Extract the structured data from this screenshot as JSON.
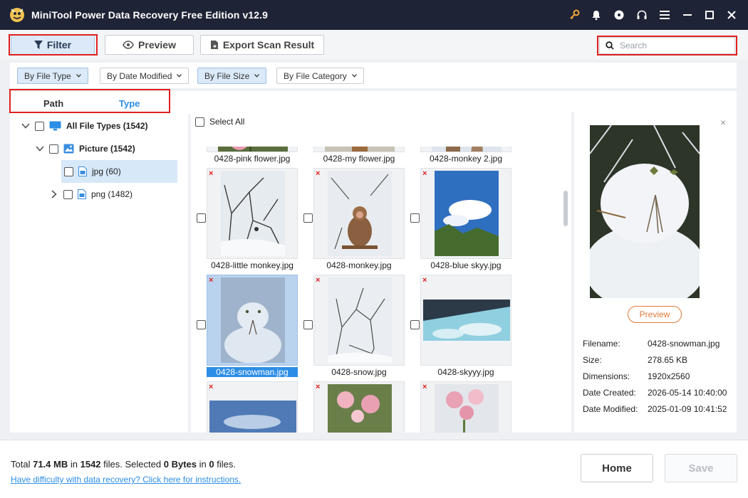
{
  "app": {
    "title": "MiniTool Power Data Recovery Free Edition v12.9"
  },
  "titlebar_icons": [
    "key-icon",
    "bell-icon",
    "disc-icon",
    "headset-icon",
    "menu-icon",
    "minimize-icon",
    "maximize-icon",
    "close-icon"
  ],
  "toolbar": {
    "filter_label": "Filter",
    "preview_label": "Preview",
    "export_label": "Export Scan Result",
    "search_placeholder": "Search"
  },
  "filters": [
    {
      "label": "By File Type",
      "active": true
    },
    {
      "label": "By Date Modified",
      "active": false
    },
    {
      "label": "By File Size",
      "active": true
    },
    {
      "label": "By File Category",
      "active": false
    }
  ],
  "tabs": {
    "path": "Path",
    "type": "Type"
  },
  "tree": {
    "all": "All File Types (1542)",
    "picture": "Picture (1542)",
    "jpg": "jpg (60)",
    "png": "png (1482)"
  },
  "grid": {
    "select_all": "Select All",
    "files": [
      {
        "name": "0428-pink flower.jpg",
        "deleted": false
      },
      {
        "name": "0428-my flower.jpg",
        "deleted": false
      },
      {
        "name": "0428-monkey 2.jpg",
        "deleted": false
      },
      {
        "name": "0428-little monkey.jpg",
        "deleted": true
      },
      {
        "name": "0428-monkey.jpg",
        "deleted": true
      },
      {
        "name": "0428-blue skyy.jpg",
        "deleted": true
      },
      {
        "name": "0428-snowman.jpg",
        "deleted": true,
        "selected": true
      },
      {
        "name": "0428-snow.jpg",
        "deleted": true
      },
      {
        "name": "0428-skyyy.jpg",
        "deleted": true
      },
      {
        "name": "",
        "deleted": true
      },
      {
        "name": "",
        "deleted": true
      },
      {
        "name": "",
        "deleted": true
      }
    ]
  },
  "preview": {
    "button": "Preview",
    "close": "×",
    "info": [
      {
        "key": "Filename:",
        "value": "0428-snowman.jpg"
      },
      {
        "key": "Size:",
        "value": "278.65 KB"
      },
      {
        "key": "Dimensions:",
        "value": "1920x2560"
      },
      {
        "key": "Date Created:",
        "value": "2026-05-14 10:40:00"
      },
      {
        "key": "Date Modified:",
        "value": "2025-01-09 10:41:52"
      }
    ]
  },
  "footer": {
    "total_prefix": "Total",
    "total_size": "71.4 MB",
    "in1": "in",
    "total_files": "1542",
    "files1": "files.",
    "selected_prefix": "Selected",
    "selected_size": "0 Bytes",
    "in2": "in",
    "selected_files": "0",
    "files2": "files.",
    "help_link": "Have difficulty with data recovery? Click here for instructions.",
    "home": "Home",
    "save": "Save"
  },
  "colors": {
    "accent": "#2d8ee6",
    "highlight": "#e02020",
    "titlebar": "#1e2336",
    "preview_orange": "#e07a3c"
  }
}
